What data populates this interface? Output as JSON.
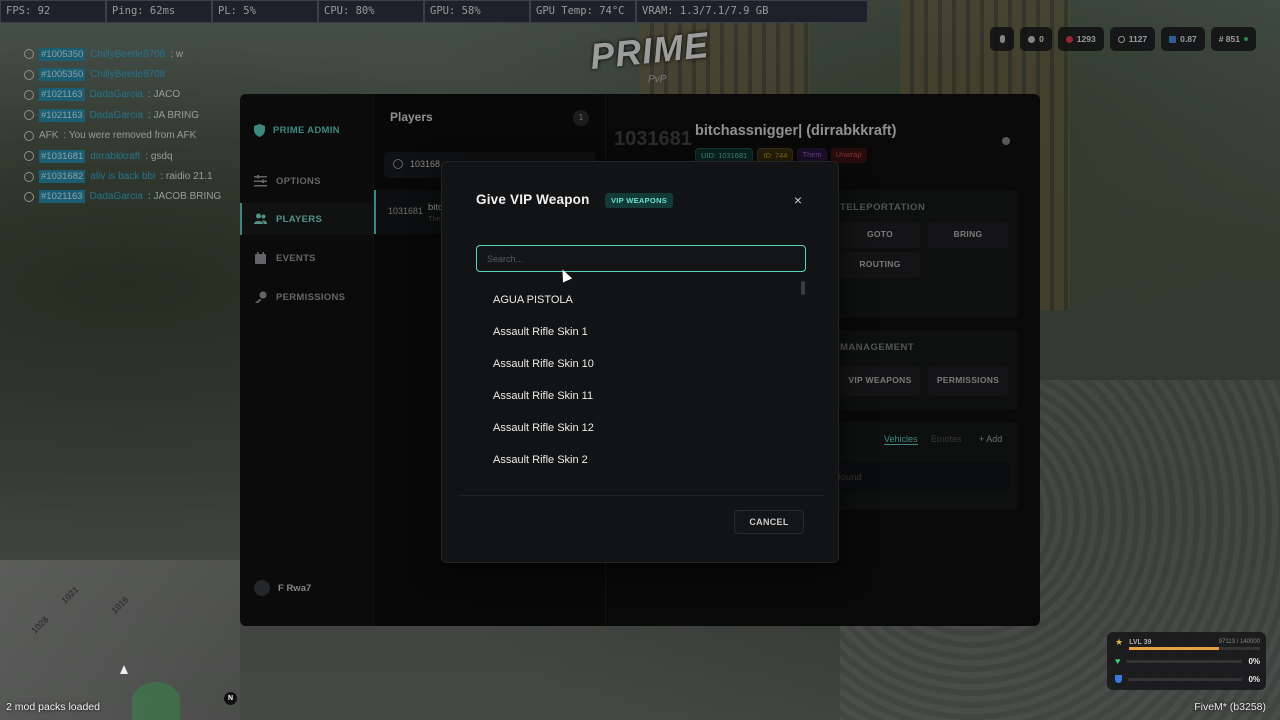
{
  "perf": [
    "FPS: 92",
    "Ping: 62ms",
    "PL: 5%",
    "CPU: 80%",
    "GPU: 58%",
    "GPU Temp: 74°C",
    "VRAM: 1.3/7.1/7.9 GB"
  ],
  "hud": {
    "stat1": "0",
    "stat2": "1293",
    "stat3": "1127",
    "stat4": "0.87",
    "server": "# 851"
  },
  "chat": [
    {
      "tag": "#1005350",
      "name": "ChillyBeetle8708",
      "msg": ": w"
    },
    {
      "tag": "#1005350",
      "name": "ChillyBeetle8708",
      "msg": ""
    },
    {
      "tag": "#1021163",
      "name": "DadaGarcia",
      "msg": ": JACO"
    },
    {
      "tag": "#1021163",
      "name": "DadaGarcia",
      "msg": ": JA BRING"
    },
    {
      "tag": "",
      "name": "AFK",
      "msg": ": You were removed from AFK"
    },
    {
      "tag": "#1031681",
      "name": "dirrabkkraft",
      "msg": ": gsdq"
    },
    {
      "tag": "#1031682",
      "name": "aliv is back bbi",
      "msg": ": raidio 21.1"
    },
    {
      "tag": "#1021163",
      "name": "DadaGarcia",
      "msg": ": JACOB BRING"
    }
  ],
  "logo": {
    "title": "PRIME",
    "sub": "PvP"
  },
  "sidebar": {
    "brand": "PRIME ADMIN",
    "items": [
      {
        "label": "OPTIONS"
      },
      {
        "label": "PLAYERS"
      },
      {
        "label": "EVENTS"
      },
      {
        "label": "PERMISSIONS"
      }
    ],
    "user": "F Rwa7"
  },
  "players": {
    "title": "Players",
    "count": "1",
    "search_value": "103168",
    "row": {
      "id": "1031681",
      "name": "bitc",
      "sub": "The"
    }
  },
  "detail": {
    "id": "1031681",
    "name": "bitchassnigger| (dirrabkkraft)",
    "badges": [
      "UID: 1031681",
      "ID: 744",
      "Them",
      "Unwrap"
    ],
    "teleport_title": "TELEPORTATION",
    "goto": "GOTO",
    "bring": "BRING",
    "routing": "ROUTING",
    "mgmt_title": "MANAGEMENT",
    "vip": "VIP WEAPONS",
    "permissions": "PERMISSIONS",
    "tab_vehicles": "Vehicles",
    "tab_emotes": "Emotes",
    "add": "+ Add",
    "empty": "found"
  },
  "modal": {
    "title": "Give VIP Weapon",
    "badge": "VIP WEAPONS",
    "close": "×",
    "search_placeholder": "Search...",
    "items": [
      "AGUA PISTOLA",
      "Assault Rifle Skin 1",
      "Assault Rifle Skin 10",
      "Assault Rifle Skin 11",
      "Assault Rifle Skin 12",
      "Assault Rifle Skin 2"
    ],
    "cancel": "CANCEL"
  },
  "minimap": {
    "mods": "2 mod packs loaded",
    "north": "N"
  },
  "status": {
    "lvl": "LVL 39",
    "xp": "97113 / 140000",
    "health": "0%",
    "armor": "0%"
  },
  "footer": "FiveM* (b3258)",
  "colors": {
    "accent": "#5fd3c3",
    "panel": "#0f0f10",
    "modal": "#121314"
  }
}
